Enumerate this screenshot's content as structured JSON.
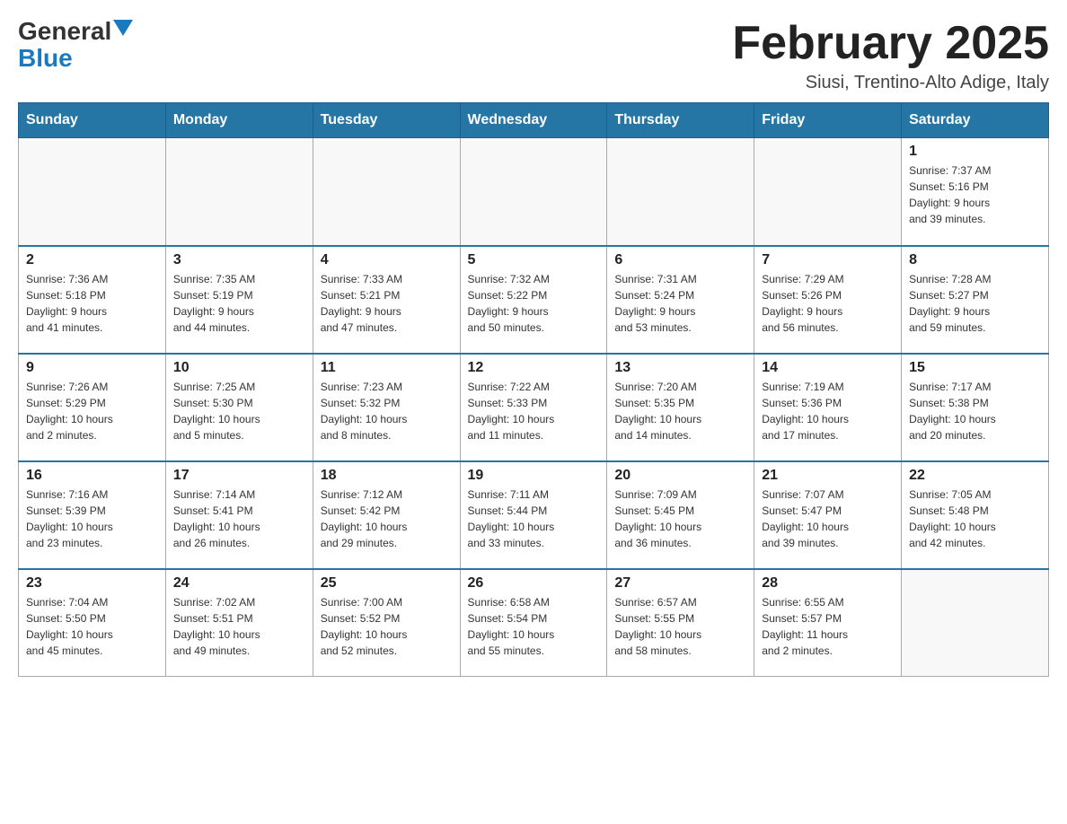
{
  "header": {
    "logo_general": "General",
    "logo_blue": "Blue",
    "title": "February 2025",
    "subtitle": "Siusi, Trentino-Alto Adige, Italy"
  },
  "days_of_week": [
    "Sunday",
    "Monday",
    "Tuesday",
    "Wednesday",
    "Thursday",
    "Friday",
    "Saturday"
  ],
  "weeks": [
    {
      "days": [
        {
          "number": "",
          "info": ""
        },
        {
          "number": "",
          "info": ""
        },
        {
          "number": "",
          "info": ""
        },
        {
          "number": "",
          "info": ""
        },
        {
          "number": "",
          "info": ""
        },
        {
          "number": "",
          "info": ""
        },
        {
          "number": "1",
          "info": "Sunrise: 7:37 AM\nSunset: 5:16 PM\nDaylight: 9 hours\nand 39 minutes."
        }
      ]
    },
    {
      "days": [
        {
          "number": "2",
          "info": "Sunrise: 7:36 AM\nSunset: 5:18 PM\nDaylight: 9 hours\nand 41 minutes."
        },
        {
          "number": "3",
          "info": "Sunrise: 7:35 AM\nSunset: 5:19 PM\nDaylight: 9 hours\nand 44 minutes."
        },
        {
          "number": "4",
          "info": "Sunrise: 7:33 AM\nSunset: 5:21 PM\nDaylight: 9 hours\nand 47 minutes."
        },
        {
          "number": "5",
          "info": "Sunrise: 7:32 AM\nSunset: 5:22 PM\nDaylight: 9 hours\nand 50 minutes."
        },
        {
          "number": "6",
          "info": "Sunrise: 7:31 AM\nSunset: 5:24 PM\nDaylight: 9 hours\nand 53 minutes."
        },
        {
          "number": "7",
          "info": "Sunrise: 7:29 AM\nSunset: 5:26 PM\nDaylight: 9 hours\nand 56 minutes."
        },
        {
          "number": "8",
          "info": "Sunrise: 7:28 AM\nSunset: 5:27 PM\nDaylight: 9 hours\nand 59 minutes."
        }
      ]
    },
    {
      "days": [
        {
          "number": "9",
          "info": "Sunrise: 7:26 AM\nSunset: 5:29 PM\nDaylight: 10 hours\nand 2 minutes."
        },
        {
          "number": "10",
          "info": "Sunrise: 7:25 AM\nSunset: 5:30 PM\nDaylight: 10 hours\nand 5 minutes."
        },
        {
          "number": "11",
          "info": "Sunrise: 7:23 AM\nSunset: 5:32 PM\nDaylight: 10 hours\nand 8 minutes."
        },
        {
          "number": "12",
          "info": "Sunrise: 7:22 AM\nSunset: 5:33 PM\nDaylight: 10 hours\nand 11 minutes."
        },
        {
          "number": "13",
          "info": "Sunrise: 7:20 AM\nSunset: 5:35 PM\nDaylight: 10 hours\nand 14 minutes."
        },
        {
          "number": "14",
          "info": "Sunrise: 7:19 AM\nSunset: 5:36 PM\nDaylight: 10 hours\nand 17 minutes."
        },
        {
          "number": "15",
          "info": "Sunrise: 7:17 AM\nSunset: 5:38 PM\nDaylight: 10 hours\nand 20 minutes."
        }
      ]
    },
    {
      "days": [
        {
          "number": "16",
          "info": "Sunrise: 7:16 AM\nSunset: 5:39 PM\nDaylight: 10 hours\nand 23 minutes."
        },
        {
          "number": "17",
          "info": "Sunrise: 7:14 AM\nSunset: 5:41 PM\nDaylight: 10 hours\nand 26 minutes."
        },
        {
          "number": "18",
          "info": "Sunrise: 7:12 AM\nSunset: 5:42 PM\nDaylight: 10 hours\nand 29 minutes."
        },
        {
          "number": "19",
          "info": "Sunrise: 7:11 AM\nSunset: 5:44 PM\nDaylight: 10 hours\nand 33 minutes."
        },
        {
          "number": "20",
          "info": "Sunrise: 7:09 AM\nSunset: 5:45 PM\nDaylight: 10 hours\nand 36 minutes."
        },
        {
          "number": "21",
          "info": "Sunrise: 7:07 AM\nSunset: 5:47 PM\nDaylight: 10 hours\nand 39 minutes."
        },
        {
          "number": "22",
          "info": "Sunrise: 7:05 AM\nSunset: 5:48 PM\nDaylight: 10 hours\nand 42 minutes."
        }
      ]
    },
    {
      "days": [
        {
          "number": "23",
          "info": "Sunrise: 7:04 AM\nSunset: 5:50 PM\nDaylight: 10 hours\nand 45 minutes."
        },
        {
          "number": "24",
          "info": "Sunrise: 7:02 AM\nSunset: 5:51 PM\nDaylight: 10 hours\nand 49 minutes."
        },
        {
          "number": "25",
          "info": "Sunrise: 7:00 AM\nSunset: 5:52 PM\nDaylight: 10 hours\nand 52 minutes."
        },
        {
          "number": "26",
          "info": "Sunrise: 6:58 AM\nSunset: 5:54 PM\nDaylight: 10 hours\nand 55 minutes."
        },
        {
          "number": "27",
          "info": "Sunrise: 6:57 AM\nSunset: 5:55 PM\nDaylight: 10 hours\nand 58 minutes."
        },
        {
          "number": "28",
          "info": "Sunrise: 6:55 AM\nSunset: 5:57 PM\nDaylight: 11 hours\nand 2 minutes."
        },
        {
          "number": "",
          "info": ""
        }
      ]
    }
  ]
}
